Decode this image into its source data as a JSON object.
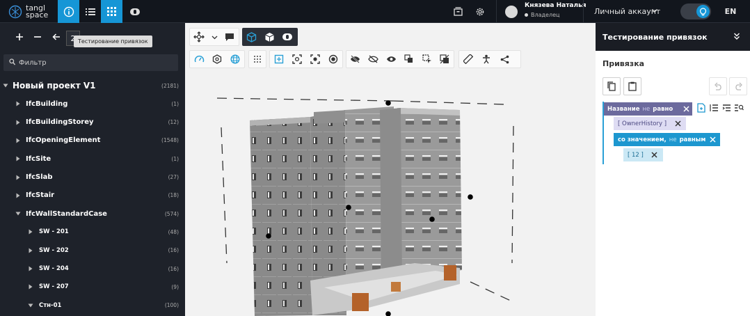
{
  "topbar": {
    "logo_line1": "tangl",
    "logo_line2": "space",
    "user_name": "Князева Наталья",
    "user_role": "Владелец",
    "account_label": "Личный аккаунт",
    "language": "EN",
    "accent_color": "#1696d6"
  },
  "left_panel": {
    "depth_value": "2",
    "tooltip": "Тестирование привязок",
    "filter_placeholder": "Фильтр",
    "tree": [
      {
        "label": "Новый проект V1",
        "count": "(2181)",
        "level": 0,
        "expanded": true
      },
      {
        "label": "IfcBuilding",
        "count": "(1)",
        "level": 1,
        "expanded": false
      },
      {
        "label": "IfcBuildingStorey",
        "count": "(12)",
        "level": 1,
        "expanded": false
      },
      {
        "label": "IfcOpeningElement",
        "count": "(1548)",
        "level": 1,
        "expanded": false
      },
      {
        "label": "IfcSite",
        "count": "(1)",
        "level": 1,
        "expanded": false
      },
      {
        "label": "IfcSlab",
        "count": "(27)",
        "level": 1,
        "expanded": false
      },
      {
        "label": "IfcStair",
        "count": "(18)",
        "level": 1,
        "expanded": false
      },
      {
        "label": "IfcWallStandardCase",
        "count": "(574)",
        "level": 1,
        "expanded": true
      },
      {
        "label": "SW - 201",
        "count": "(48)",
        "level": 2,
        "expanded": false
      },
      {
        "label": "SW - 202",
        "count": "(16)",
        "level": 2,
        "expanded": false
      },
      {
        "label": "SW - 204",
        "count": "(16)",
        "level": 2,
        "expanded": false
      },
      {
        "label": "SW - 207",
        "count": "(9)",
        "level": 2,
        "expanded": false
      },
      {
        "label": "Стн-01",
        "count": "(100)",
        "level": 2,
        "expanded": true
      }
    ]
  },
  "right_panel": {
    "title": "Тестирование привязок",
    "subtitle": "Привязка",
    "rule_name_label": "Название",
    "rule_name_negation": "не",
    "rule_name_op": "равно",
    "rule_value": "[ OwnerHistory ]",
    "rule_eq_label": "со значением,",
    "rule_eq_negation": "не",
    "rule_eq_op": "равным",
    "rule_number": "[ 12 ]"
  }
}
